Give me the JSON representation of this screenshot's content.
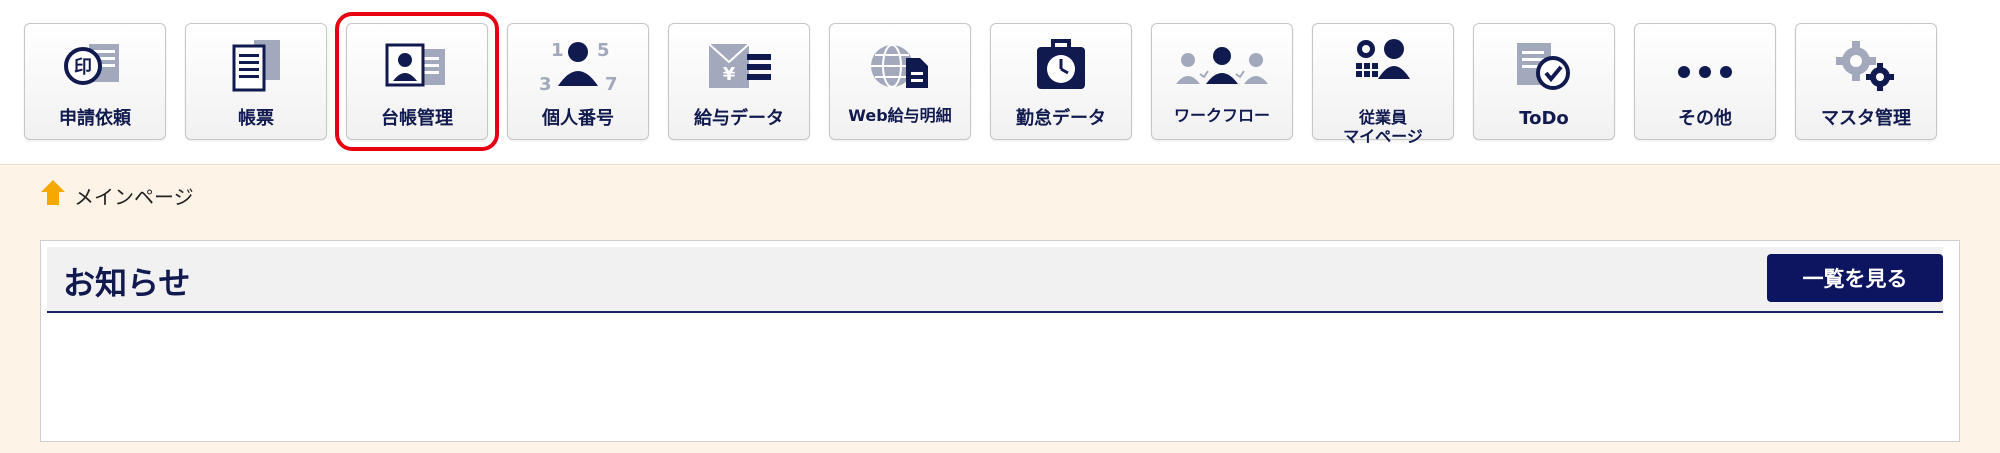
{
  "nav": {
    "items": [
      {
        "label": "申請依頼",
        "icon": "stamp-document-icon"
      },
      {
        "label": "帳票",
        "icon": "document-list-icon"
      },
      {
        "label": "台帳管理",
        "icon": "ledger-person-icon",
        "selected": true
      },
      {
        "label": "個人番号",
        "icon": "person-number-icon"
      },
      {
        "label": "給与データ",
        "icon": "yen-envelope-icon"
      },
      {
        "label": "Web給与明細",
        "icon": "globe-document-icon"
      },
      {
        "label": "勤怠データ",
        "icon": "clock-icon"
      },
      {
        "label": "ワークフロー",
        "icon": "people-flow-icon"
      },
      {
        "label": "従業員\nマイページ",
        "icon": "employee-gear-icon"
      },
      {
        "label": "ToDo",
        "icon": "todo-check-icon"
      },
      {
        "label": "その他",
        "icon": "more-dots-icon"
      },
      {
        "label": "マスタ管理",
        "icon": "gears-icon"
      }
    ],
    "selected_outline_color": "#e60012"
  },
  "breadcrumb": {
    "icon": "home-icon",
    "label": "メインページ"
  },
  "notices": {
    "title": "お知らせ",
    "view_all_label": "一覧を見る"
  },
  "colors": {
    "navy": "#111a4f",
    "background": "#fdf3e6",
    "home_icon": "#f5a800"
  }
}
